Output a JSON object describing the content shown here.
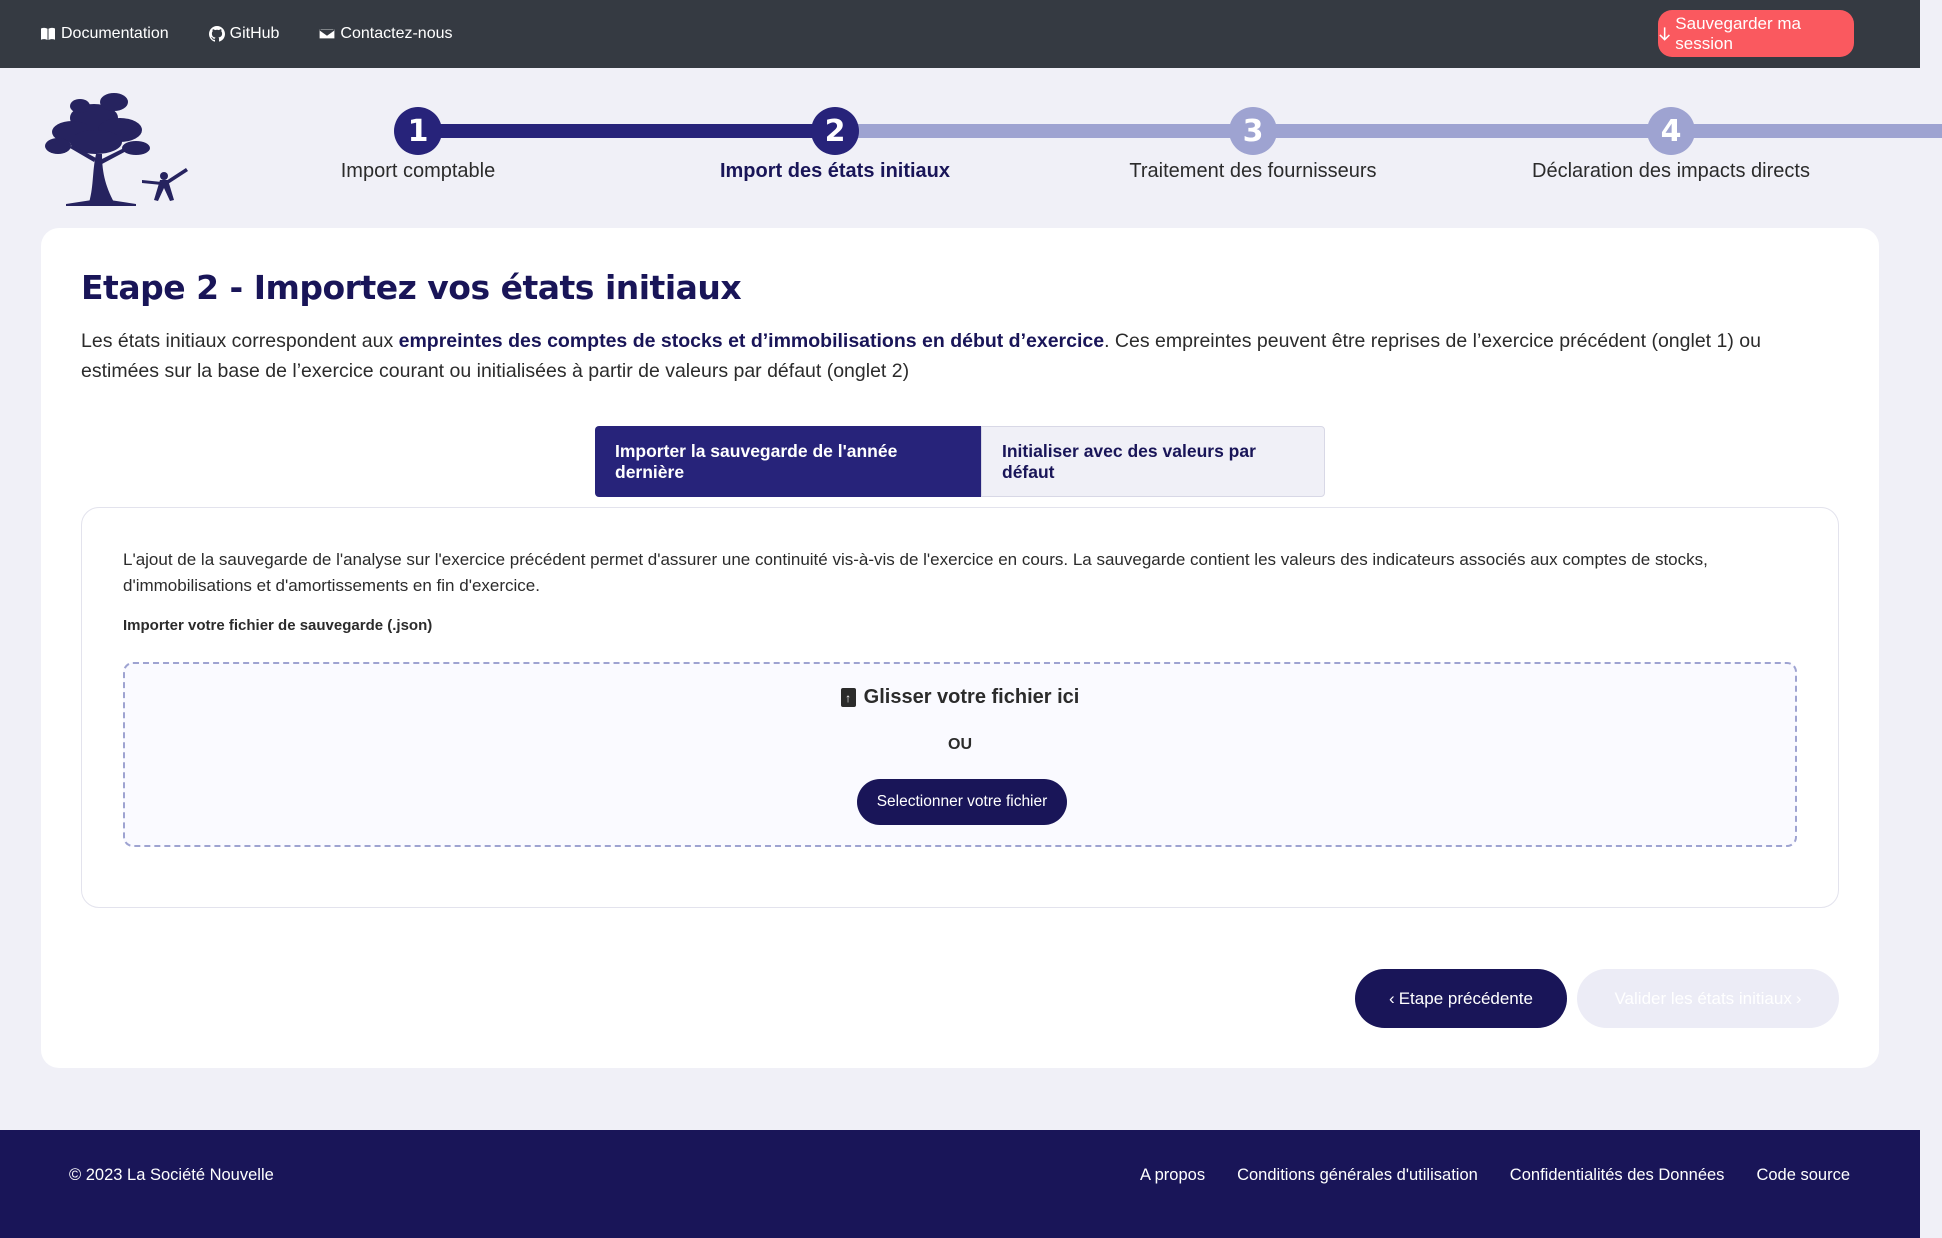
{
  "topbar": {
    "links": [
      {
        "label": "Documentation",
        "icon": "book-icon"
      },
      {
        "label": "GitHub",
        "icon": "github-icon"
      },
      {
        "label": "Contactez-nous",
        "icon": "envelope-icon"
      }
    ],
    "save_label": "Sauvegarder ma session",
    "save_color": "#fa595f",
    "bar_color": "#353a42"
  },
  "stepper": {
    "steps": [
      {
        "number": "1",
        "label": "Import comptable",
        "state": "done"
      },
      {
        "number": "2",
        "label": "Import des états initiaux",
        "state": "current"
      },
      {
        "number": "3",
        "label": "Traitement des fournisseurs",
        "state": "todo"
      },
      {
        "number": "4",
        "label": "Déclaration des impacts directs",
        "state": "todo"
      }
    ],
    "active_color": "#27237a",
    "inactive_color": "#9ea3d1"
  },
  "main": {
    "title": "Etape 2 - Importez vos états initiaux",
    "desc_prefix": "Les états initiaux correspondent aux ",
    "desc_bold": "empreintes des comptes de stocks et d’immobilisations en début d’exercice",
    "desc_suffix": ". Ces empreintes peuvent être reprises de l’exercice précédent (onglet 1) ou estimées sur la base de l’exercice courant ou initialisées à partir de valeurs par défaut (onglet 2)",
    "tabs": [
      {
        "label": "Importer la sauvegarde de l'année dernière",
        "active": true
      },
      {
        "label": "Initialiser avec des valeurs par défaut",
        "active": false
      }
    ],
    "panel": {
      "text": "L'ajout de la sauvegarde de l'analyse sur l'exercice précédent permet d'assurer une continuité vis-à-vis de l'exercice en cours. La sauvegarde contient les valeurs des indicateurs associés aux comptes de stocks, d'immobilisations et d'amortissements en fin d'exercice.",
      "file_label": "Importer votre fichier de sauvegarde (.json)",
      "dropzone_title": "Glisser votre fichier ici",
      "dropzone_or": "OU",
      "select_button": "Selectionner votre fichier"
    },
    "prev_button": "Etape précédente",
    "next_button": "Valider les états initiaux"
  },
  "footer": {
    "copyright": "© 2023 La Société Nouvelle",
    "links": [
      "A propos",
      "Conditions générales d'utilisation",
      "Confidentialités des Données",
      "Code source"
    ]
  }
}
